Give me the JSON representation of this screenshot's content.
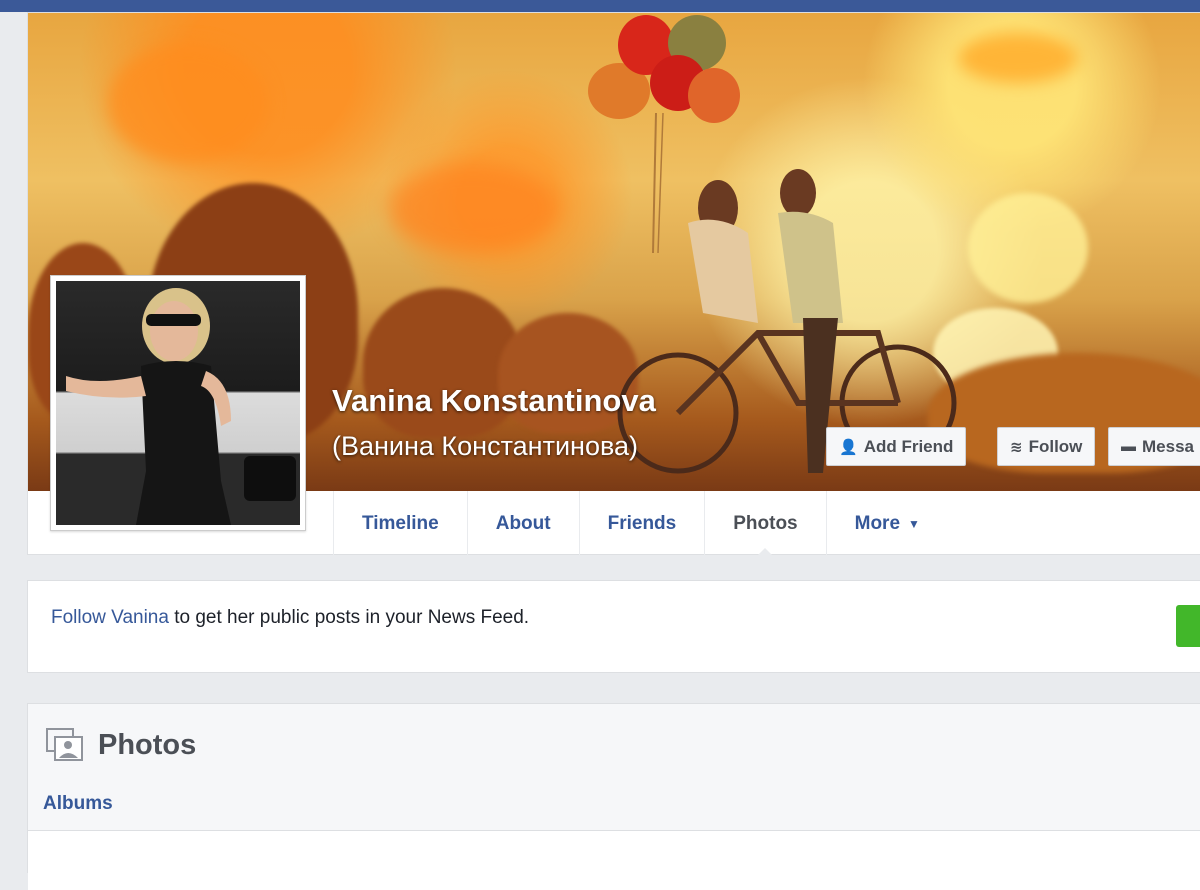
{
  "profile": {
    "name": "Vanina Konstantinova",
    "alternate_name": "(Ванина Константинова)"
  },
  "cover_actions": {
    "add_friend": "Add Friend",
    "follow": "Follow",
    "message": "Messa"
  },
  "nav": {
    "tabs": [
      "Timeline",
      "About",
      "Friends",
      "Photos",
      "More"
    ],
    "active": "Photos"
  },
  "follow_prompt": {
    "link": "Follow Vanina",
    "text": " to get her public posts in your News Feed."
  },
  "photos": {
    "title": "Photos",
    "albums": "Albums"
  },
  "colors": {
    "topbar": "#3b5998",
    "link": "#365899",
    "follow_green": "#42b72a"
  },
  "icons": {
    "add_friend": "add-friend-icon",
    "follow": "rss-icon",
    "message": "message-icon",
    "photos": "photos-icon",
    "more": "chevron-down-icon"
  }
}
